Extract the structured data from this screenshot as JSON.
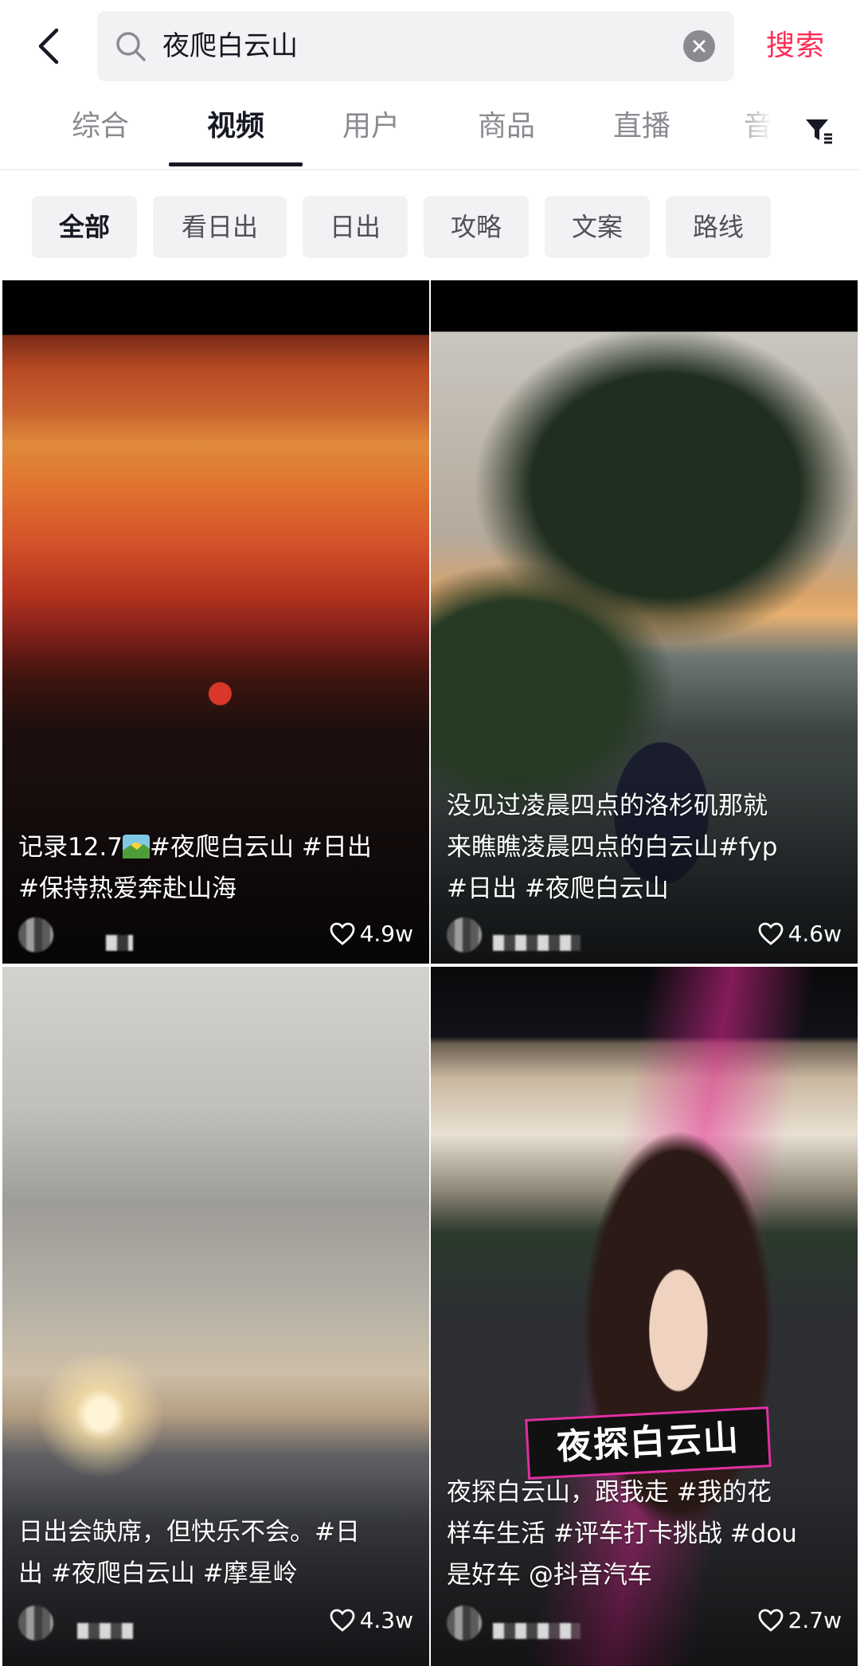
{
  "search": {
    "query": "夜爬白云山",
    "submit_label": "搜索"
  },
  "tabs": [
    {
      "label": "综合",
      "active": false
    },
    {
      "label": "视频",
      "active": true
    },
    {
      "label": "用户",
      "active": false
    },
    {
      "label": "商品",
      "active": false
    },
    {
      "label": "直播",
      "active": false
    },
    {
      "label": "音",
      "active": false
    }
  ],
  "chips": [
    {
      "label": "全部",
      "active": true
    },
    {
      "label": "看日出",
      "active": false
    },
    {
      "label": "日出",
      "active": false
    },
    {
      "label": "攻略",
      "active": false
    },
    {
      "label": "文案",
      "active": false
    },
    {
      "label": "路线",
      "active": false
    }
  ],
  "videos": [
    {
      "caption_line1_pre": "记录12.7",
      "caption_line1_post": "#夜爬白云山 #日出",
      "caption_line2": "#保持热爱奔赴山海",
      "likes": "4.9w",
      "icon": "sunrise-emoji"
    },
    {
      "caption_line1": "没见过凌晨四点的洛杉矶那就",
      "caption_line2": "来瞧瞧凌晨四点的白云山#fyp",
      "caption_line3": "#日出 #夜爬白云山",
      "likes": "4.6w"
    },
    {
      "caption_line1": "日出会缺席，但快乐不会。#日",
      "caption_line2": "出 #夜爬白云山 #摩星岭",
      "likes": "4.3w"
    },
    {
      "overlay_title": "夜探白云山",
      "caption_line1": "夜探白云山，跟我走 #我的花",
      "caption_line2": "样车生活 #评车打卡挑战 #dou",
      "caption_line3": "是好车 @抖音汽车",
      "likes": "2.7w"
    }
  ],
  "colors": {
    "accent": "#fe2c55",
    "text_primary": "#161823",
    "text_secondary": "#8a8b91",
    "chip_bg": "#f2f2f4"
  }
}
